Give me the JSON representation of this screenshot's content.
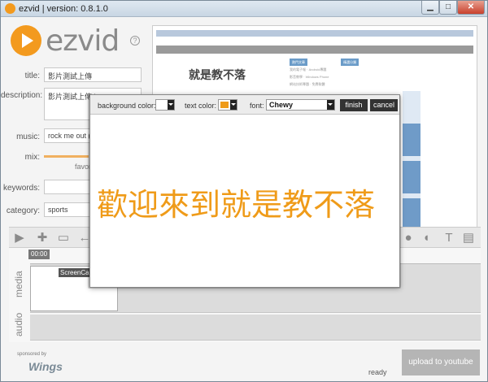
{
  "window": {
    "title": "ezvid | version: 0.8.1.0",
    "min": "▁",
    "max": "□",
    "close": "✕"
  },
  "logo": {
    "text": "ezvid",
    "help": "?"
  },
  "form": {
    "title_label": "title:",
    "title_value": "影片測試上傳",
    "description_label": "description:",
    "description_value": "影片測試上傳 by",
    "music_label": "music:",
    "music_value": "rock me out (bb",
    "mix_label": "mix:",
    "mix_favor": "favor",
    "keywords_label": "keywords:",
    "keywords_value": "",
    "category_label": "category:",
    "category_value": "sports"
  },
  "preview": {
    "logo_text": "就是教不落",
    "col1_header": "熱門文章",
    "col2_header": "精選分類",
    "col1_items": [
      "我的電子報",
      "影音教學",
      "網站技術專題"
    ],
    "col2_items": [
      "Android專題",
      "Windows Phone",
      "免費軟體"
    ]
  },
  "timeline": {
    "time": "00:00",
    "media_label": "media",
    "audio_label": "audio",
    "clip_name": "ScreenCap"
  },
  "footer": {
    "sponsor": "sponsored by",
    "sponsor_logo": "Wings",
    "status": "ready",
    "upload": "upload to youtube"
  },
  "dialog": {
    "bg_color_label": "background color:",
    "text_color_label": "text color:",
    "font_label": "font:",
    "font_value": "Chewy",
    "finish": "finish",
    "cancel": "cancel",
    "text": "歡迎來到就是教不落",
    "bg_color": "#ffffff",
    "text_color": "#ef9b19"
  }
}
